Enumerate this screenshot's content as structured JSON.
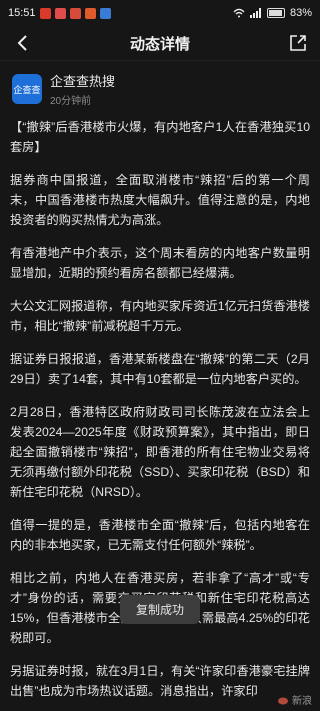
{
  "status": {
    "time": "15:51",
    "battery": "83%"
  },
  "nav": {
    "title": "动态详情",
    "back_icon": "back-arrow-icon",
    "share_icon": "share-icon"
  },
  "author": {
    "name": "企查查热搜",
    "time": "20分钟前",
    "avatar_text": "企查查"
  },
  "paragraphs": [
    "【“撤辣”后香港楼市火爆，有内地客户1人在香港独买10套房】",
    "据券商中国报道，全面取消楼市“辣招”后的第一个周末，中国香港楼市热度大幅飙升。值得注意的是，内地投资者的购买热情尤为高涨。",
    "有香港地产中介表示，这个周末看房的内地客户数量明显增加，近期的预约看房名额都已经爆满。",
    "大公文汇网报道称，有内地买家斥资近1亿元扫货香港楼市，相比“撤辣”前减税超千万元。",
    "据证券日报报道，香港某新楼盘在“撤辣”的第二天（2月29日）卖了14套，其中有10套都是一位内地客户买的。",
    "2月28日，香港特区政府财政司司长陈茂波在立法会上发表2024—2025年度《财政预算案》，其中指出，即日起全面撤销楼市“辣招”，即香港的所有住宅物业交易将无须再缴付额外印花税（SSD）、买家印花税（BSD）和新住宅印花税（NRSD）。",
    "值得一提的是，香港楼市全面“撤辣”后，包括内地客在内的非本地买家，已无需支付任何额外“辣税”。",
    "相比之前，内地人在香港买房，若非拿了“高才”或“专才”身份的话，需要交买家印花税和新住宅印花税高达15%，但香港楼市全面“撤辣”后，只需最高4.25%的印花税即可。",
    "另据证券时报，就在3月1日，有关“许家印香港豪宅挂牌出售”也成为市场热议话题。消息指出，许家印"
  ],
  "toast": "复制成功",
  "watermark": "新浪"
}
